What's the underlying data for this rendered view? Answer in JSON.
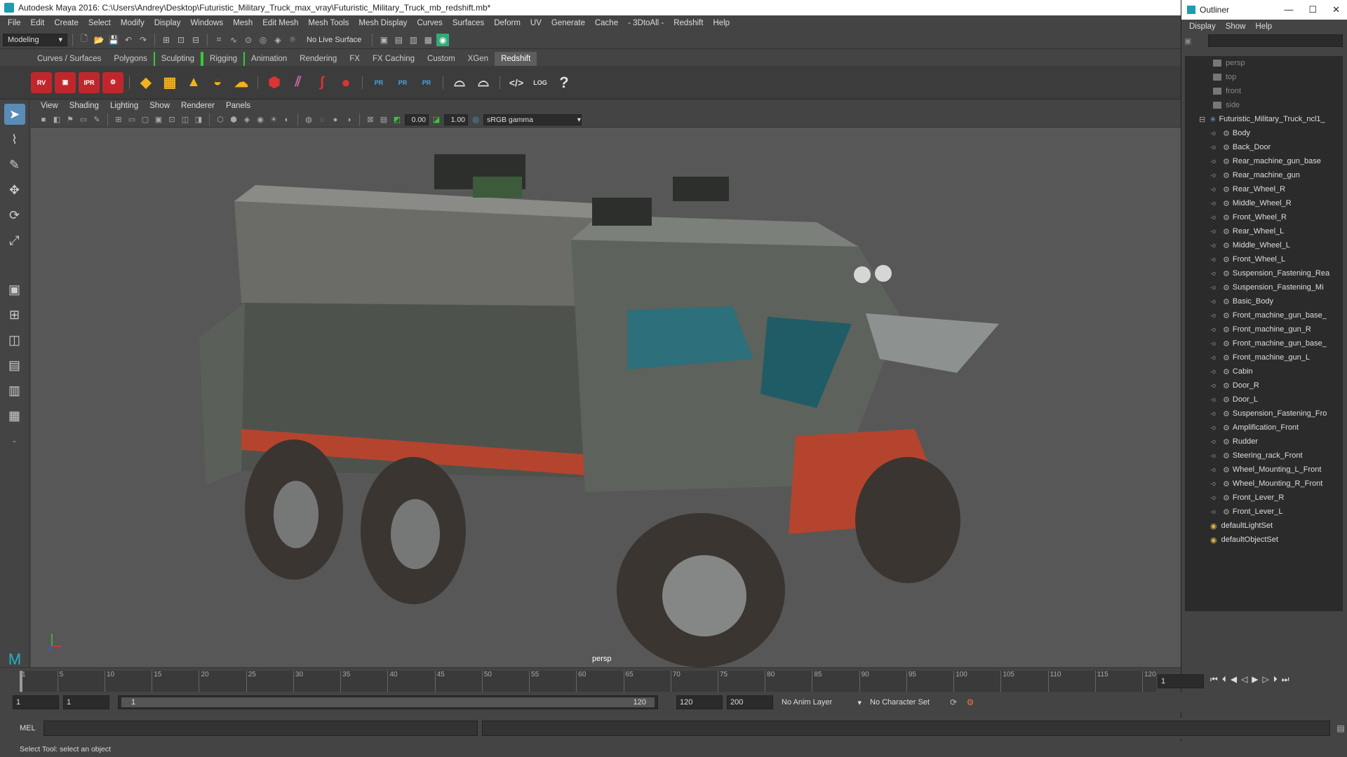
{
  "window": {
    "title": "Autodesk Maya 2016: C:\\Users\\Andrey\\Desktop\\Futuristic_Military_Truck_max_vray\\Futuristic_Military_Truck_mb_redshift.mb*"
  },
  "menu": [
    "File",
    "Edit",
    "Create",
    "Select",
    "Modify",
    "Display",
    "Windows",
    "Mesh",
    "Edit Mesh",
    "Mesh Tools",
    "Mesh Display",
    "Curves",
    "Surfaces",
    "Deform",
    "UV",
    "Generate",
    "Cache",
    "- 3DtoAll -",
    "Redshift",
    "Help"
  ],
  "status": {
    "mode": "Modeling",
    "live_surface": "No Live Surface"
  },
  "shelf_tabs": [
    "Curves / Surfaces",
    "Polygons",
    "Sculpting",
    "Rigging",
    "Animation",
    "Rendering",
    "FX",
    "FX Caching",
    "Custom",
    "XGen",
    "Redshift"
  ],
  "shelf_labels": {
    "rv": "RV",
    "ipr": "IPR",
    "pr1": "PR",
    "pr2": "PR",
    "pr3": "PR",
    "log": "LOG",
    "help": "?"
  },
  "panel_menu": [
    "View",
    "Shading",
    "Lighting",
    "Show",
    "Renderer",
    "Panels"
  ],
  "panel_tools": {
    "exposure": "0.00",
    "gamma_value": "1.00",
    "color_space": "sRGB gamma"
  },
  "viewport": {
    "camera_label": "persp"
  },
  "outliner": {
    "title": "Outliner",
    "menu": [
      "Display",
      "Show",
      "Help"
    ],
    "cameras": [
      "persp",
      "top",
      "front",
      "side"
    ],
    "root": "Futuristic_Military_Truck_ncl1_",
    "children": [
      "Body",
      "Back_Door",
      "Rear_machine_gun_base",
      "Rear_machine_gun",
      "Rear_Wheel_R",
      "Middle_Wheel_R",
      "Front_Wheel_R",
      "Rear_Wheel_L",
      "Middle_Wheel_L",
      "Front_Wheel_L",
      "Suspension_Fastening_Rea",
      "Suspension_Fastening_Mi",
      "Basic_Body",
      "Front_machine_gun_base_",
      "Front_machine_gun_R",
      "Front_machine_gun_base_",
      "Front_machine_gun_L",
      "Cabin",
      "Door_R",
      "Door_L",
      "Suspension_Fastening_Fro",
      "Amplification_Front",
      "Rudder",
      "Steering_rack_Front",
      "Wheel_Mounting_L_Front",
      "Wheel_Mounting_R_Front",
      "Front_Lever_R",
      "Front_Lever_L"
    ],
    "sets": [
      "defaultLightSet",
      "defaultObjectSet"
    ]
  },
  "timeline": {
    "ticks": [
      "1",
      "5",
      "10",
      "15",
      "20",
      "25",
      "30",
      "35",
      "40",
      "45",
      "50",
      "55",
      "60",
      "65",
      "70",
      "75",
      "80",
      "85",
      "90",
      "95",
      "100",
      "105",
      "110",
      "115",
      "120"
    ],
    "current_frame": "1"
  },
  "range": {
    "start": "1",
    "start2": "1",
    "slider_start": "1",
    "slider_end": "120",
    "end": "120",
    "end2": "200",
    "anim_layer": "No Anim Layer",
    "char_set": "No Character Set"
  },
  "command": {
    "lang": "MEL"
  },
  "help_line": "Select Tool: select an object"
}
